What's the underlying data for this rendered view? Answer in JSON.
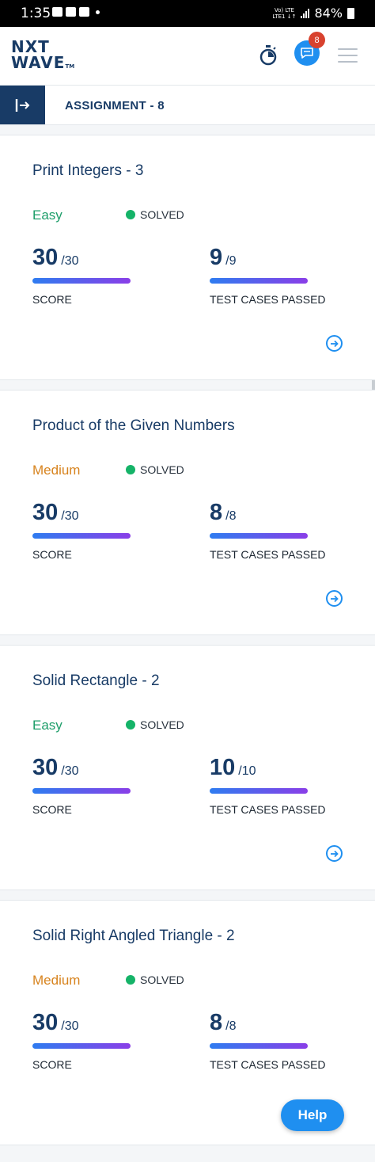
{
  "status_bar": {
    "time": "1:35",
    "lte": "Vo) LTE\nLTE1 ↓↑",
    "battery": "84%"
  },
  "header": {
    "logo_line1": "NXT",
    "logo_line2": "WAVE",
    "logo_tm": "TM",
    "notification_count": "8"
  },
  "subbar": {
    "title": "ASSIGNMENT - 8"
  },
  "labels": {
    "score": "SCORE",
    "test_cases": "TEST CASES PASSED",
    "solved": "SOLVED"
  },
  "problems": [
    {
      "title": "Print Integers - 3",
      "difficulty": "Easy",
      "status": "SOLVED",
      "score": "30",
      "score_max": "/30",
      "tests": "9",
      "tests_max": "/9"
    },
    {
      "title": "Product of the Given Numbers",
      "difficulty": "Medium",
      "status": "SOLVED",
      "score": "30",
      "score_max": "/30",
      "tests": "8",
      "tests_max": "/8"
    },
    {
      "title": "Solid Rectangle - 2",
      "difficulty": "Easy",
      "status": "SOLVED",
      "score": "30",
      "score_max": "/30",
      "tests": "10",
      "tests_max": "/10"
    },
    {
      "title": "Solid Right Angled Triangle - 2",
      "difficulty": "Medium",
      "status": "SOLVED",
      "score": "30",
      "score_max": "/30",
      "tests": "8",
      "tests_max": "/8"
    }
  ],
  "help_button": "Help",
  "colors": {
    "primary": "#183b66",
    "accent": "#1f8ff0",
    "easy": "#1e9e6a",
    "medium": "#d7831e",
    "solved": "#15b368",
    "badge": "#d8422e"
  }
}
